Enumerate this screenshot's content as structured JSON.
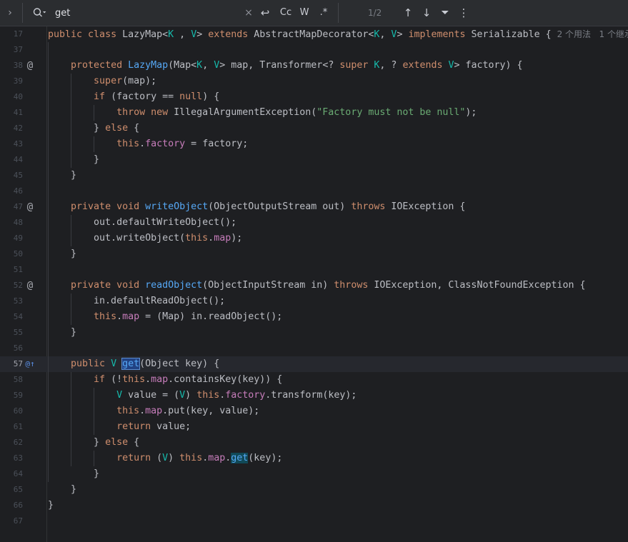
{
  "search": {
    "query": "get",
    "match_count": "1/2",
    "buttons": {
      "close": "×",
      "newline": "↩",
      "match_case": "Cc",
      "words": "W",
      "regex": ".*",
      "prev": "↑",
      "next": "↓",
      "filter": "⏷",
      "more": "⋮"
    }
  },
  "editor": {
    "lines": [
      {
        "n": "17",
        "segs": [
          [
            "kw",
            "public "
          ],
          [
            "kw",
            "class "
          ],
          [
            "",
            "LazyMap<"
          ],
          [
            "ty",
            "K"
          ],
          [
            "",
            " , "
          ],
          [
            "ty",
            "V"
          ],
          [
            "",
            "> "
          ],
          [
            "kw",
            "extends "
          ],
          [
            "",
            "AbstractMapDecorator<"
          ],
          [
            "ty",
            "K"
          ],
          [
            "",
            ", "
          ],
          [
            "ty",
            "V"
          ],
          [
            "",
            "> "
          ],
          [
            "kw",
            "implements "
          ],
          [
            "",
            "Serializable { "
          ],
          [
            "hint",
            "2 个用法   1 个继承"
          ]
        ]
      },
      {
        "n": "37",
        "segs": []
      },
      {
        "n": "38",
        "mark": "@",
        "segs": [
          [
            "",
            "    "
          ],
          [
            "kw",
            "protected "
          ],
          [
            "fn",
            "LazyMap"
          ],
          [
            "",
            "(Map<"
          ],
          [
            "ty",
            "K"
          ],
          [
            "",
            ", "
          ],
          [
            "ty",
            "V"
          ],
          [
            "",
            "> map, Transformer<? "
          ],
          [
            "kw",
            "super "
          ],
          [
            "ty",
            "K"
          ],
          [
            "",
            ", ? "
          ],
          [
            "kw",
            "extends "
          ],
          [
            "ty",
            "V"
          ],
          [
            "",
            "> factory) {"
          ]
        ]
      },
      {
        "n": "39",
        "segs": [
          [
            "",
            "        "
          ],
          [
            "kw",
            "super"
          ],
          [
            "",
            "(map);"
          ]
        ]
      },
      {
        "n": "40",
        "segs": [
          [
            "",
            "        "
          ],
          [
            "kw",
            "if "
          ],
          [
            "",
            "(factory == "
          ],
          [
            "kw",
            "null"
          ],
          [
            "",
            ") {"
          ]
        ]
      },
      {
        "n": "41",
        "segs": [
          [
            "",
            "            "
          ],
          [
            "kw",
            "throw new "
          ],
          [
            "",
            "IllegalArgumentException("
          ],
          [
            "st",
            "\"Factory must not be null\""
          ],
          [
            "",
            ");"
          ]
        ]
      },
      {
        "n": "42",
        "segs": [
          [
            "",
            "        } "
          ],
          [
            "kw",
            "else "
          ],
          [
            "",
            "{"
          ]
        ]
      },
      {
        "n": "43",
        "segs": [
          [
            "",
            "            "
          ],
          [
            "kw",
            "this"
          ],
          [
            "",
            "."
          ],
          [
            "fd",
            "factory"
          ],
          [
            "",
            " = factory;"
          ]
        ]
      },
      {
        "n": "44",
        "segs": [
          [
            "",
            "        }"
          ]
        ]
      },
      {
        "n": "45",
        "segs": [
          [
            "",
            "    }"
          ]
        ]
      },
      {
        "n": "46",
        "segs": []
      },
      {
        "n": "47",
        "mark": "@",
        "segs": [
          [
            "",
            "    "
          ],
          [
            "kw",
            "private void "
          ],
          [
            "fn",
            "writeObject"
          ],
          [
            "",
            "(ObjectOutputStream out) "
          ],
          [
            "kw",
            "throws "
          ],
          [
            "",
            "IOException {"
          ]
        ]
      },
      {
        "n": "48",
        "segs": [
          [
            "",
            "        out.defaultWriteObject();"
          ]
        ]
      },
      {
        "n": "49",
        "segs": [
          [
            "",
            "        out.writeObject("
          ],
          [
            "kw",
            "this"
          ],
          [
            "",
            "."
          ],
          [
            "fd",
            "map"
          ],
          [
            "",
            ");"
          ]
        ]
      },
      {
        "n": "50",
        "segs": [
          [
            "",
            "    }"
          ]
        ]
      },
      {
        "n": "51",
        "segs": []
      },
      {
        "n": "52",
        "mark": "@",
        "segs": [
          [
            "",
            "    "
          ],
          [
            "kw",
            "private void "
          ],
          [
            "fn",
            "readObject"
          ],
          [
            "",
            "(ObjectInputStream in) "
          ],
          [
            "kw",
            "throws "
          ],
          [
            "",
            "IOException, ClassNotFoundException {"
          ]
        ]
      },
      {
        "n": "53",
        "segs": [
          [
            "",
            "        in.defaultReadObject();"
          ]
        ]
      },
      {
        "n": "54",
        "segs": [
          [
            "",
            "        "
          ],
          [
            "kw",
            "this"
          ],
          [
            "",
            "."
          ],
          [
            "fd",
            "map"
          ],
          [
            "",
            " = (Map) in.readObject();"
          ]
        ]
      },
      {
        "n": "55",
        "segs": [
          [
            "",
            "    }"
          ]
        ]
      },
      {
        "n": "56",
        "segs": []
      },
      {
        "n": "57",
        "mark": "impl",
        "current": true,
        "segs": [
          [
            "",
            "    "
          ],
          [
            "kw",
            "public "
          ],
          [
            "ty",
            "V "
          ],
          [
            "sel",
            "get"
          ],
          [
            "",
            "(Object key) {"
          ]
        ]
      },
      {
        "n": "58",
        "segs": [
          [
            "",
            "        "
          ],
          [
            "kw",
            "if "
          ],
          [
            "",
            "(!"
          ],
          [
            "kw",
            "this"
          ],
          [
            "",
            "."
          ],
          [
            "fd",
            "map"
          ],
          [
            "",
            ".containsKey(key)) {"
          ]
        ]
      },
      {
        "n": "59",
        "segs": [
          [
            "",
            "            "
          ],
          [
            "ty",
            "V "
          ],
          [
            "",
            "value = ("
          ],
          [
            "ty",
            "V"
          ],
          [
            "",
            ") "
          ],
          [
            "kw",
            "this"
          ],
          [
            "",
            "."
          ],
          [
            "fd",
            "factory"
          ],
          [
            "",
            ".transform(key);"
          ]
        ]
      },
      {
        "n": "60",
        "segs": [
          [
            "",
            "            "
          ],
          [
            "kw",
            "this"
          ],
          [
            "",
            "."
          ],
          [
            "fd",
            "map"
          ],
          [
            "",
            ".put(key, value);"
          ]
        ]
      },
      {
        "n": "61",
        "segs": [
          [
            "",
            "            "
          ],
          [
            "kw",
            "return "
          ],
          [
            "",
            "value;"
          ]
        ]
      },
      {
        "n": "62",
        "segs": [
          [
            "",
            "        } "
          ],
          [
            "kw",
            "else "
          ],
          [
            "",
            "{"
          ]
        ]
      },
      {
        "n": "63",
        "segs": [
          [
            "",
            "            "
          ],
          [
            "kw",
            "return "
          ],
          [
            "",
            "("
          ],
          [
            "ty",
            "V"
          ],
          [
            "",
            ") "
          ],
          [
            "kw",
            "this"
          ],
          [
            "",
            "."
          ],
          [
            "fd",
            "map"
          ],
          [
            "",
            "."
          ],
          [
            "match",
            "get"
          ],
          [
            "",
            "(key);"
          ]
        ]
      },
      {
        "n": "64",
        "segs": [
          [
            "",
            "        }"
          ]
        ]
      },
      {
        "n": "65",
        "segs": [
          [
            "",
            "    }"
          ]
        ]
      },
      {
        "n": "66",
        "segs": [
          [
            "",
            "}"
          ]
        ]
      },
      {
        "n": "67",
        "segs": []
      }
    ]
  }
}
